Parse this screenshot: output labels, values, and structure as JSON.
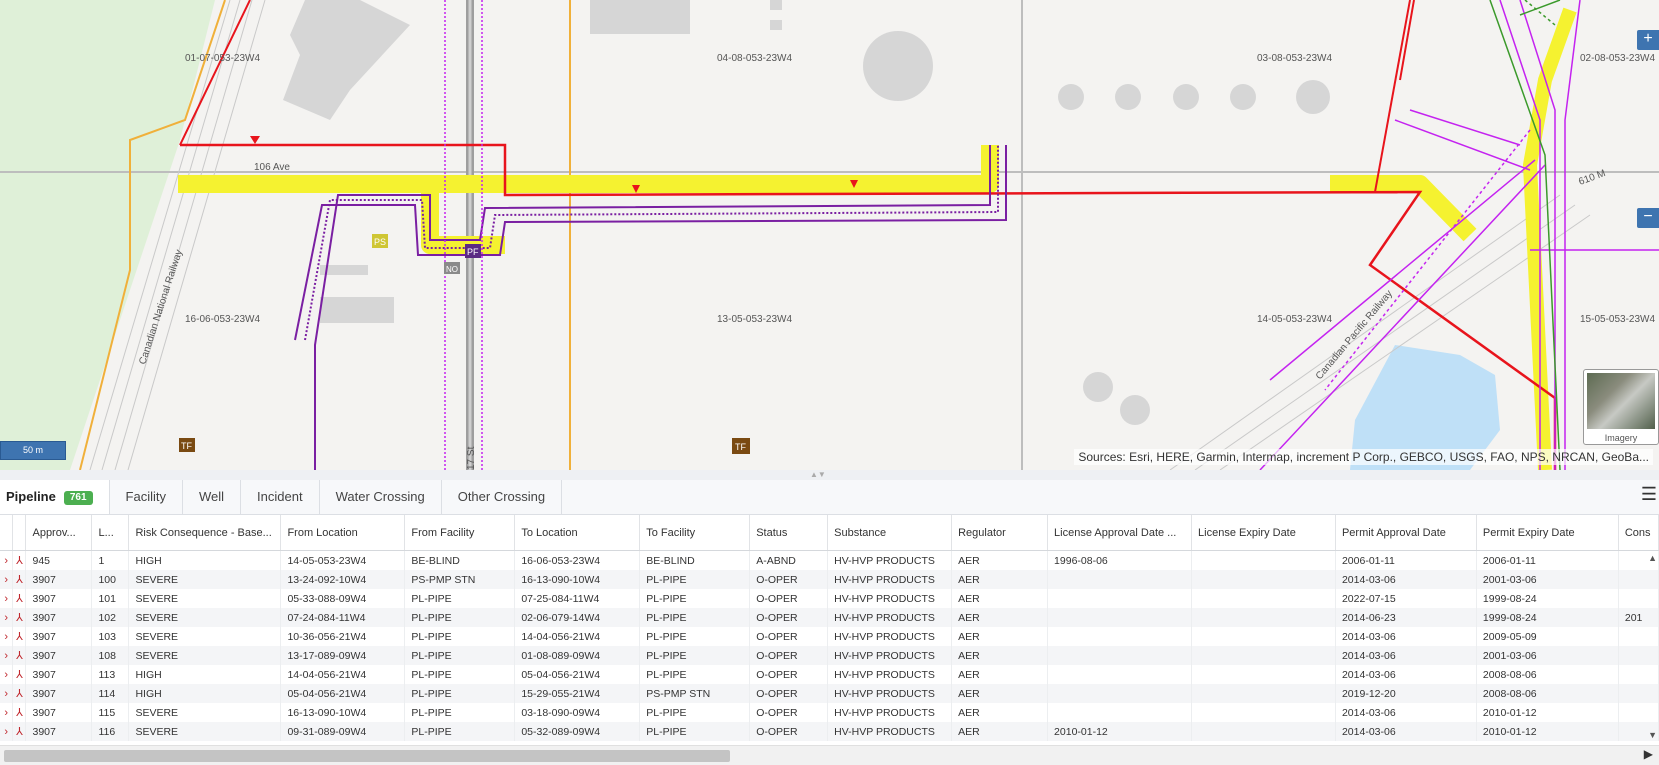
{
  "map": {
    "labels": {
      "lsd_01_07": "01-07-053-23W4",
      "lsd_04_08": "04-08-053-23W4",
      "lsd_03_08": "03-08-053-23W4",
      "lsd_02_08": "02-08-053-23W4",
      "lsd_16_06": "16-06-053-23W4",
      "lsd_13_05": "13-05-053-23W4",
      "lsd_14_05": "14-05-053-23W4",
      "lsd_15_05": "15-05-053-23W4",
      "road_106": "106 Ave",
      "railway_cn": "Canadian National Railway",
      "railway_cp": "Canadian Pacific Railway",
      "street_17": "17 St",
      "marker_ps": "PS",
      "marker_pf": "PF",
      "marker_no": "NO",
      "marker_tf1": "TF",
      "marker_tf2": "TF",
      "road_610": "610 M"
    },
    "attribution": "Sources: Esri, HERE, Garmin, Intermap, increment P Corp., GEBCO, USGS, FAO, NPS, NRCAN, GeoBa...",
    "scale_label": "50 m",
    "zoom_in": "+",
    "zoom_out": "−",
    "basemap_toggle_label": "Imagery",
    "colors": {
      "highlight": "#f5f230",
      "pipeline_red": "#e8141c",
      "pipeline_purple": "#7a1fa2",
      "pipeline_magenta": "#c423f0",
      "pipeline_green": "#3b9a2b",
      "pipeline_orange": "#f0b03a"
    }
  },
  "tabs": {
    "pipeline": "Pipeline",
    "pipeline_count": "761",
    "facility": "Facility",
    "well": "Well",
    "incident": "Incident",
    "water_crossing": "Water Crossing",
    "other_crossing": "Other Crossing"
  },
  "table": {
    "columns": [
      "Approv...",
      "L...",
      "Risk Consequence - Base...",
      "From Location",
      "From Facility",
      "To Location",
      "To Facility",
      "Status",
      "Substance",
      "Regulator",
      "License Approval Date ...",
      "License Expiry Date",
      "Permit Approval Date",
      "Permit Expiry Date",
      "Cons"
    ],
    "row_icon": "pipeline-icon",
    "rows": [
      [
        "945",
        "1",
        "HIGH",
        "14-05-053-23W4",
        "BE-BLIND",
        "16-06-053-23W4",
        "BE-BLIND",
        "A-ABND",
        "HV-HVP PRODUCTS",
        "AER",
        "1996-08-06",
        "",
        "2006-01-11",
        "2006-01-11",
        ""
      ],
      [
        "3907",
        "100",
        "SEVERE",
        "13-24-092-10W4",
        "PS-PMP STN",
        "16-13-090-10W4",
        "PL-PIPE",
        "O-OPER",
        "HV-HVP PRODUCTS",
        "AER",
        "",
        "",
        "2014-03-06",
        "2001-03-06",
        ""
      ],
      [
        "3907",
        "101",
        "SEVERE",
        "05-33-088-09W4",
        "PL-PIPE",
        "07-25-084-11W4",
        "PL-PIPE",
        "O-OPER",
        "HV-HVP PRODUCTS",
        "AER",
        "",
        "",
        "2022-07-15",
        "1999-08-24",
        ""
      ],
      [
        "3907",
        "102",
        "SEVERE",
        "07-24-084-11W4",
        "PL-PIPE",
        "02-06-079-14W4",
        "PL-PIPE",
        "O-OPER",
        "HV-HVP PRODUCTS",
        "AER",
        "",
        "",
        "2014-06-23",
        "1999-08-24",
        "201"
      ],
      [
        "3907",
        "103",
        "SEVERE",
        "10-36-056-21W4",
        "PL-PIPE",
        "14-04-056-21W4",
        "PL-PIPE",
        "O-OPER",
        "HV-HVP PRODUCTS",
        "AER",
        "",
        "",
        "2014-03-06",
        "2009-05-09",
        ""
      ],
      [
        "3907",
        "108",
        "SEVERE",
        "13-17-089-09W4",
        "PL-PIPE",
        "01-08-089-09W4",
        "PL-PIPE",
        "O-OPER",
        "HV-HVP PRODUCTS",
        "AER",
        "",
        "",
        "2014-03-06",
        "2001-03-06",
        ""
      ],
      [
        "3907",
        "113",
        "HIGH",
        "14-04-056-21W4",
        "PL-PIPE",
        "05-04-056-21W4",
        "PL-PIPE",
        "O-OPER",
        "HV-HVP PRODUCTS",
        "AER",
        "",
        "",
        "2014-03-06",
        "2008-08-06",
        ""
      ],
      [
        "3907",
        "114",
        "HIGH",
        "05-04-056-21W4",
        "PL-PIPE",
        "15-29-055-21W4",
        "PS-PMP STN",
        "O-OPER",
        "HV-HVP PRODUCTS",
        "AER",
        "",
        "",
        "2019-12-20",
        "2008-08-06",
        ""
      ],
      [
        "3907",
        "115",
        "SEVERE",
        "16-13-090-10W4",
        "PL-PIPE",
        "03-18-090-09W4",
        "PL-PIPE",
        "O-OPER",
        "HV-HVP PRODUCTS",
        "AER",
        "",
        "",
        "2014-03-06",
        "2010-01-12",
        ""
      ],
      [
        "3907",
        "116",
        "SEVERE",
        "09-31-089-09W4",
        "PL-PIPE",
        "05-32-089-09W4",
        "PL-PIPE",
        "O-OPER",
        "HV-HVP PRODUCTS",
        "AER",
        "2010-01-12",
        "",
        "2014-03-06",
        "2010-01-12",
        ""
      ]
    ]
  }
}
